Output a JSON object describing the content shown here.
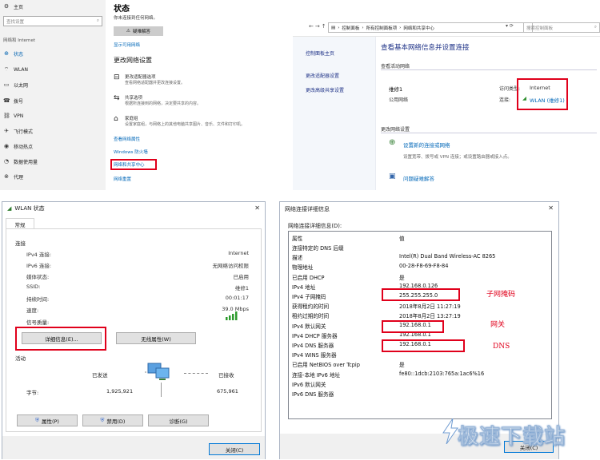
{
  "settings": {
    "home": "主页",
    "search_placeholder": "查找设置",
    "section": "网络和 Internet",
    "nav": [
      "状态",
      "WLAN",
      "以太网",
      "拨号",
      "VPN",
      "飞行模式",
      "移动热点",
      "数据使用量",
      "代理"
    ],
    "title": "状态",
    "subtitle": "你未连接到任何网络。",
    "troubleshoot": "疑难解答",
    "show_networks": "显示可用网络",
    "change_heading": "更改网络设置",
    "items": [
      {
        "title": "更改适配器选项",
        "desc": "查看网络适配器并更改连接设置。"
      },
      {
        "title": "共享选项",
        "desc": "根据所连接到的网络，决定要共享的内容。"
      },
      {
        "title": "家庭组",
        "desc": "设置家庭组，与网络上的其他电脑共享图片、音乐、文件和打印机。"
      }
    ],
    "links": [
      "查看网络属性",
      "Windows 防火墙",
      "网络和共享中心",
      "网络重置"
    ]
  },
  "nsc": {
    "address": [
      "控制面板",
      "所有控制面板项",
      "网络和共享中心"
    ],
    "search_placeholder": "搜索控制面板",
    "left_links": [
      "控制面板主页",
      "更改适配器设置",
      "更改高级共享设置"
    ],
    "heading": "查看基本网络信息并设置连接",
    "active_label": "查看活动网络",
    "network_name": "维修1",
    "network_type": "公用网络",
    "access_type_label": "访问类型:",
    "access_type_value": "Internet",
    "connection_label": "连接:",
    "connection_value": "WLAN (维修1)",
    "change_label": "更改网络设置",
    "setup_link": "设置新的连接或网络",
    "setup_desc": "设置宽带、拨号或 VPN 连接；或设置路由器或接入点。",
    "troubleshoot_link": "问题疑难解答"
  },
  "wlan": {
    "title": "WLAN 状态",
    "tab": "常规",
    "connection_group": "连接",
    "rows": [
      {
        "label": "IPv4 连接:",
        "value": "Internet"
      },
      {
        "label": "IPv6 连接:",
        "value": "无网络访问权限"
      },
      {
        "label": "媒体状态:",
        "value": "已启用"
      },
      {
        "label": "SSID:",
        "value": "维修1"
      },
      {
        "label": "持续时间:",
        "value": "00:01:17"
      },
      {
        "label": "速度:",
        "value": "39.0 Mbps"
      }
    ],
    "signal_label": "信号质量:",
    "details_btn": "详细信息(E)...",
    "wireless_btn": "无线属性(W)",
    "activity_group": "活动",
    "sent_label": "已发送",
    "received_label": "已接收",
    "bytes_label": "字节:",
    "bytes_sent": "1,925,921",
    "bytes_received": "675,961",
    "properties_btn": "属性(P)",
    "disable_btn": "禁用(D)",
    "diagnose_btn": "诊断(G)",
    "close_btn": "关闭(C)"
  },
  "details": {
    "title": "网络连接详细信息",
    "label": "网络连接详细信息(D):",
    "col_prop": "属性",
    "col_value": "值",
    "rows": [
      {
        "prop": "连接特定的 DNS 后缀",
        "value": ""
      },
      {
        "prop": "描述",
        "value": "Intel(R) Dual Band Wireless-AC 8265"
      },
      {
        "prop": "物理地址",
        "value": "00-28-F8-69-F8-84"
      },
      {
        "prop": "已启用 DHCP",
        "value": "是"
      },
      {
        "prop": "IPv4 地址",
        "value": "192.168.0.126"
      },
      {
        "prop": "IPv4 子网掩码",
        "value": "255.255.255.0"
      },
      {
        "prop": "获得租约的时间",
        "value": "2018年8月2日 11:27:19"
      },
      {
        "prop": "租约过期的时间",
        "value": "2018年8月2日 13:27:19"
      },
      {
        "prop": "IPv4 默认网关",
        "value": "192.168.0.1"
      },
      {
        "prop": "IPv4 DHCP 服务器",
        "value": "192.168.0.1"
      },
      {
        "prop": "IPv4 DNS 服务器",
        "value": "192.168.0.1"
      },
      {
        "prop": "IPv4 WINS 服务器",
        "value": ""
      },
      {
        "prop": "已启用 NetBIOS over Tcpip",
        "value": "是"
      },
      {
        "prop": "连接-本地 IPv6 地址",
        "value": "fe80::1dcb:2103:765a:1ac6%16"
      },
      {
        "prop": "IPv6 默认网关",
        "value": ""
      },
      {
        "prop": "IPv6 DNS 服务器",
        "value": ""
      }
    ],
    "anno_subnet": "子网掩码",
    "anno_gateway": "网关",
    "anno_dns": "DNS",
    "close_btn": "关闭(C)"
  },
  "watermark": "极速下载站"
}
